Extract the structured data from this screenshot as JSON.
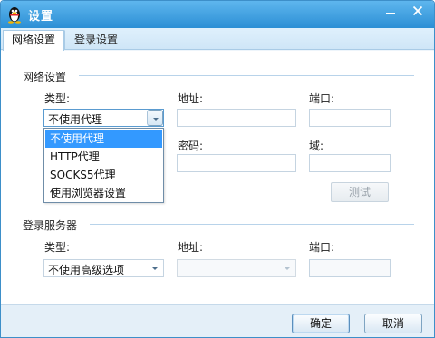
{
  "window": {
    "title": "设置",
    "close_icon": "close-icon",
    "minimize_icon": "minimize-icon"
  },
  "tabs": [
    {
      "label": "网络设置",
      "active": true
    },
    {
      "label": "登录设置",
      "active": false
    }
  ],
  "network": {
    "section_title": "网络设置",
    "type_label": "类型:",
    "type_value": "不使用代理",
    "address_label": "地址:",
    "address_value": "",
    "port_label": "端口:",
    "port_value": "",
    "password_label": "密码:",
    "password_value": "",
    "domain_label": "域:",
    "domain_value": "",
    "test_button": "测试",
    "dropdown_options": [
      "不使用代理",
      "HTTP代理",
      "SOCKS5代理",
      "使用浏览器设置"
    ]
  },
  "login_server": {
    "section_title": "登录服务器",
    "type_label": "类型:",
    "type_value": "不使用高级选项",
    "address_label": "地址:",
    "address_value": "",
    "port_label": "端口:",
    "port_value": ""
  },
  "footer": {
    "ok_label": "确定",
    "cancel_label": "取消"
  },
  "colors": {
    "accent": "#3399ff",
    "titlebar": "#2c8fd5"
  }
}
